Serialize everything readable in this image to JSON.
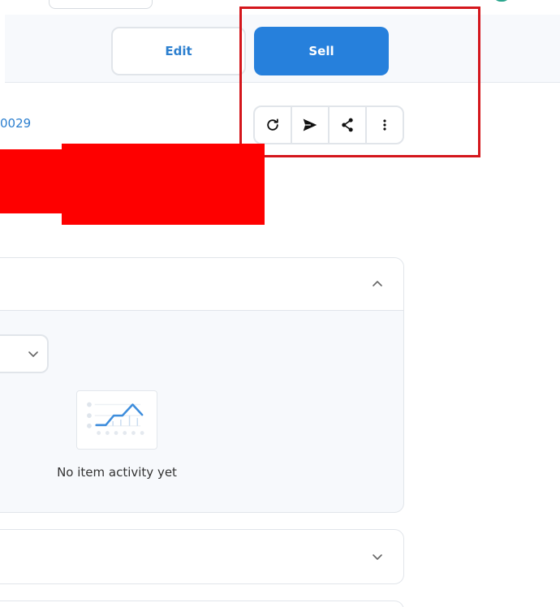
{
  "header": {
    "edit_label": "Edit",
    "sell_label": "Sell"
  },
  "toolbar_icons": [
    "refresh-icon",
    "send-icon",
    "share-icon",
    "more-vertical-icon"
  ],
  "item": {
    "id_fragment": "0029"
  },
  "activity": {
    "empty_message": "No item activity yet"
  },
  "colors": {
    "primary": "#2680dc",
    "link": "#2c7fcf",
    "highlight": "#d4161c",
    "redaction": "#fe0000",
    "panel_bg": "#f7f9fc",
    "border": "#e1e5ea"
  }
}
